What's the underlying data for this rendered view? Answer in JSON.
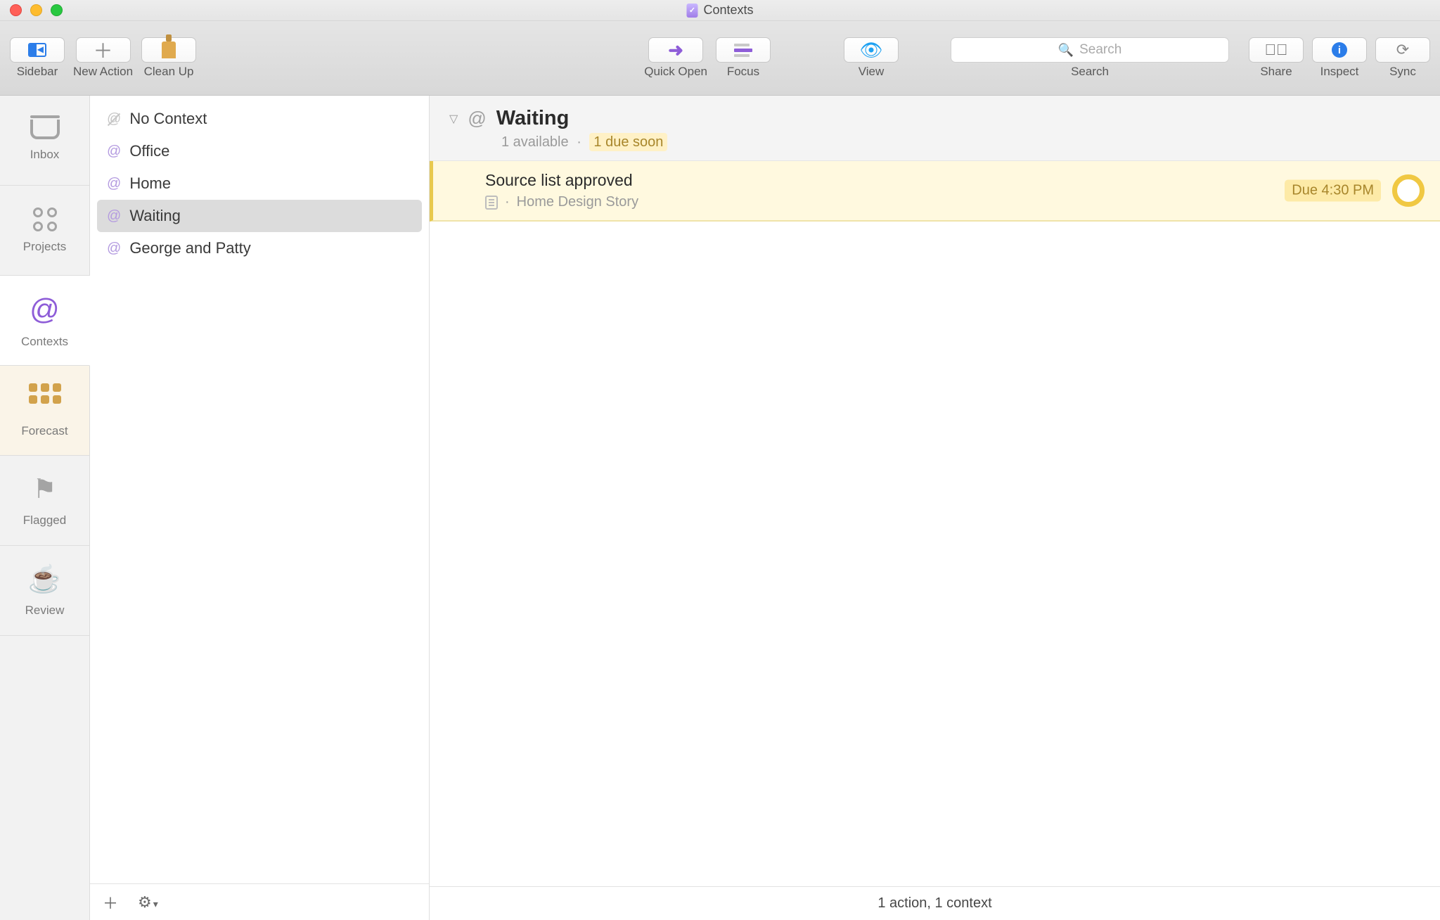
{
  "window": {
    "title": "Contexts"
  },
  "toolbar": {
    "sidebar": "Sidebar",
    "newAction": "New Action",
    "cleanUp": "Clean Up",
    "quickOpen": "Quick Open",
    "focus": "Focus",
    "view": "View",
    "search": "Search",
    "searchPlaceholder": "Search",
    "share": "Share",
    "inspect": "Inspect",
    "sync": "Sync"
  },
  "rail": {
    "inbox": "Inbox",
    "projects": "Projects",
    "contexts": "Contexts",
    "forecast": "Forecast",
    "flagged": "Flagged",
    "review": "Review"
  },
  "contexts": {
    "items": [
      {
        "name": "No Context",
        "noContext": true
      },
      {
        "name": "Office"
      },
      {
        "name": "Home"
      },
      {
        "name": "Waiting",
        "selected": true
      },
      {
        "name": "George and Patty"
      }
    ],
    "header": {
      "title": "Waiting",
      "available": "1 available",
      "dueSoon": "1 due soon"
    }
  },
  "tasks": [
    {
      "title": "Source list approved",
      "project": "Home Design Story",
      "due": "Due 4:30 PM"
    }
  ],
  "status": "1 action, 1 context",
  "glyphs": {
    "at": "@",
    "dot": "·",
    "gear": "⚙",
    "chevronDown": "▾",
    "plus": "＋",
    "disclosure": "▽"
  }
}
